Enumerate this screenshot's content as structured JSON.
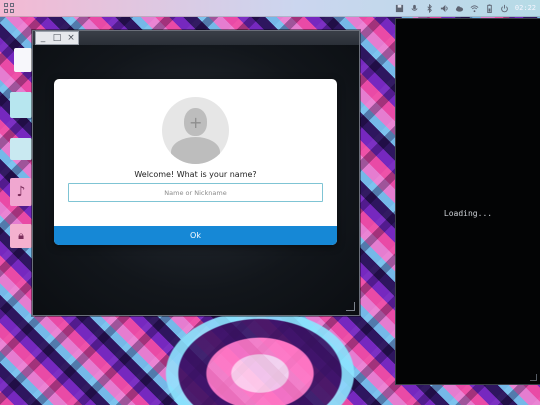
{
  "topbar": {
    "clock": "02:22",
    "icons": [
      "apps-grid-icon",
      "save-icon",
      "microphone-icon",
      "bluetooth-icon",
      "volume-icon",
      "cloud-icon",
      "wifi-icon",
      "battery-icon",
      "power-icon"
    ],
    "colors": {
      "left": "#f3b9d3",
      "right": "#b6dbe6"
    }
  },
  "window": {
    "controls": [
      "_",
      "□",
      "×"
    ]
  },
  "dialog": {
    "prompt": "Welcome! What is your name?",
    "input_placeholder": "Name or Nickname",
    "input_value": "",
    "ok_label": "Ok",
    "accent": "#1688d6"
  },
  "terminal": {
    "status": "Loading..."
  }
}
